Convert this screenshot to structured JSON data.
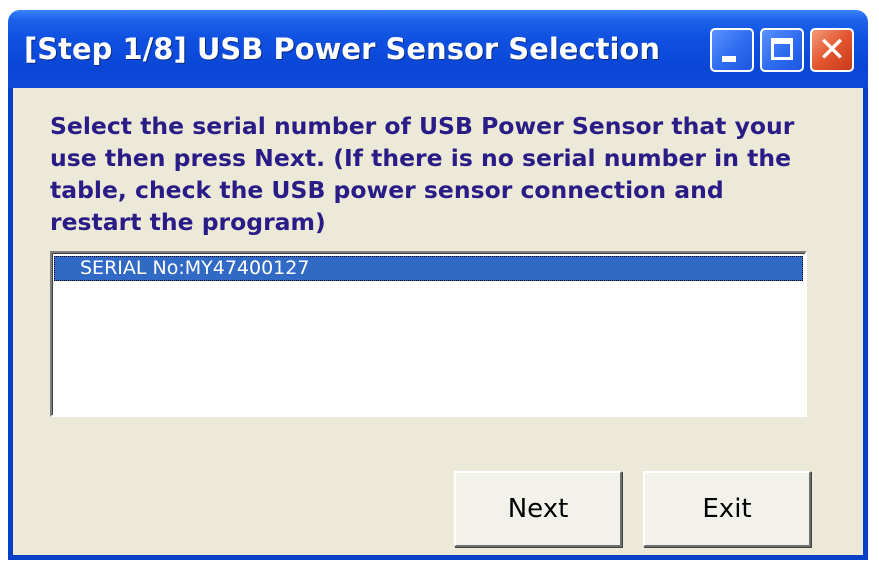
{
  "window": {
    "title": "[Step 1/8] USB Power Sensor Selection",
    "controls": {
      "minimize": "minimize-icon",
      "maximize": "maximize-icon",
      "close": "close-icon",
      "close_glyph": "✕"
    }
  },
  "instructions": "Select the serial number of USB Power Sensor that your use then press Next. (If there is no serial number in the table, check the USB power sensor connection and restart the program)",
  "sensor_list": {
    "items": [
      {
        "label": "SERIAL No:MY47400127",
        "selected": true
      }
    ]
  },
  "buttons": {
    "next": "Next",
    "exit": "Exit"
  },
  "colors": {
    "title_bar": "#0a46d6",
    "instruction_text": "#2a1c86",
    "selection": "#316ac5",
    "dialog_background": "#ece9d8"
  }
}
